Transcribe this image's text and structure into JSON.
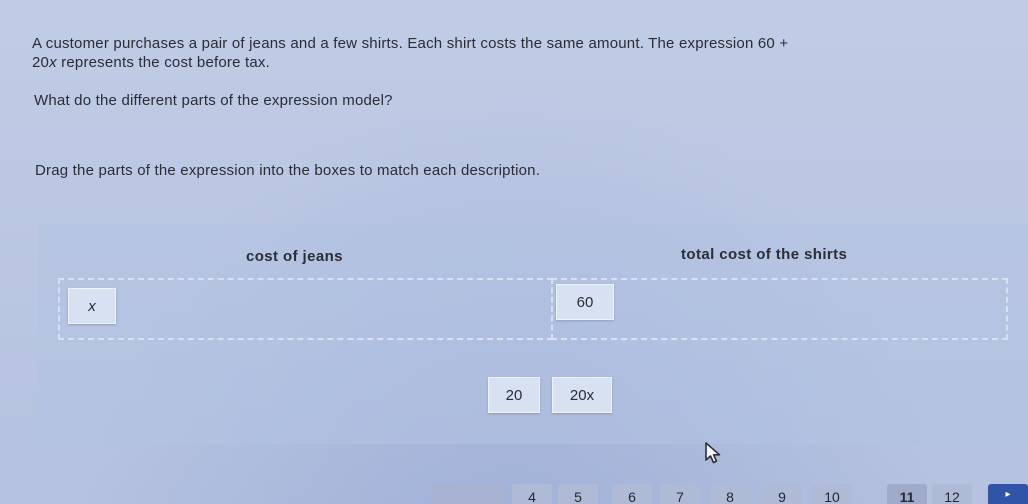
{
  "question": {
    "line1": "A customer purchases a pair of jeans and a few shirts. Each shirt costs the same amount. The expression 60 +",
    "line2_expr": "20",
    "line2_var": "x",
    "line2_rest": " represents the cost before tax.",
    "prompt": "What do the different parts of the expression model?"
  },
  "instruction": "Drag the parts of the expression into the boxes to match each description.",
  "columns": [
    {
      "label": "cost of jeans"
    },
    {
      "label": "total cost of the shirts"
    }
  ],
  "tiles": {
    "in_jeans": "x",
    "in_shirts": "60",
    "bank": [
      "20",
      "20x"
    ]
  },
  "pagination": {
    "pages": [
      "",
      "4",
      "5",
      "6",
      "7",
      "8",
      "9",
      "10",
      "11",
      "12"
    ],
    "current": "11",
    "next_glyph": "▸"
  },
  "icons": {
    "cursor": "mouse-pointer-icon",
    "next": "next-arrow-icon"
  },
  "colors": {
    "background": "#bdc9e4",
    "tile": "#d7e1f2",
    "next_button": "#2f54a8"
  }
}
